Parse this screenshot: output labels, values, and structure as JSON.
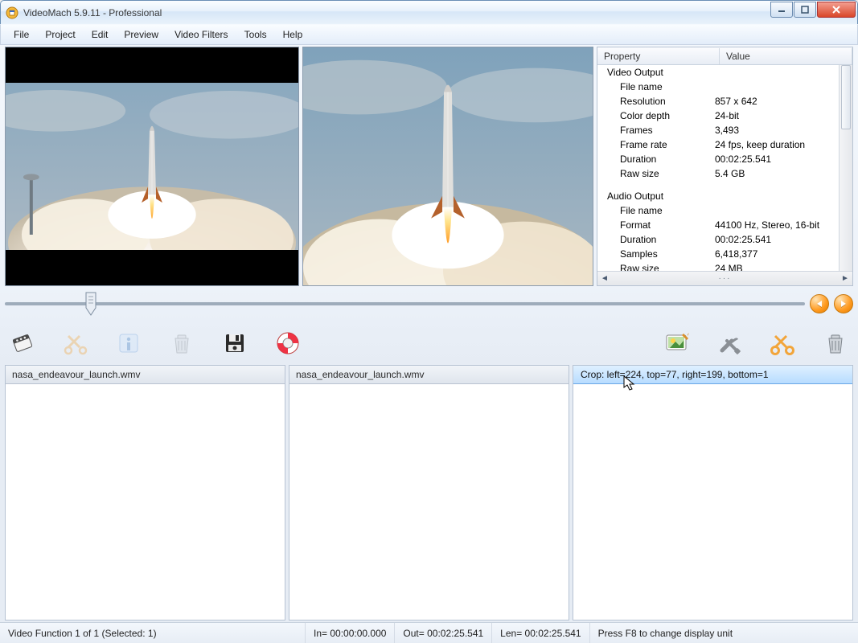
{
  "window": {
    "title": "VideoMach 5.9.11 - Professional"
  },
  "menu": {
    "items": [
      "File",
      "Project",
      "Edit",
      "Preview",
      "Video Filters",
      "Tools",
      "Help"
    ]
  },
  "properties": {
    "header_property": "Property",
    "header_value": "Value",
    "groups": [
      {
        "title": "Video Output",
        "rows": [
          {
            "name": "File name",
            "value": ""
          },
          {
            "name": "Resolution",
            "value": "857 x 642"
          },
          {
            "name": "Color depth",
            "value": "24-bit"
          },
          {
            "name": "Frames",
            "value": "3,493"
          },
          {
            "name": "Frame rate",
            "value": "24 fps, keep duration"
          },
          {
            "name": "Duration",
            "value": "00:02:25.541"
          },
          {
            "name": "Raw size",
            "value": "5.4 GB"
          }
        ]
      },
      {
        "title": "Audio Output",
        "rows": [
          {
            "name": "File name",
            "value": ""
          },
          {
            "name": "Format",
            "value": "44100 Hz, Stereo, 16-bit"
          },
          {
            "name": "Duration",
            "value": "00:02:25.541"
          },
          {
            "name": "Samples",
            "value": "6,418,377"
          },
          {
            "name": "Raw size",
            "value": "24 MB"
          }
        ]
      }
    ]
  },
  "lists": {
    "left_item": "nasa_endeavour_launch.wmv",
    "mid_item": "nasa_endeavour_launch.wmv",
    "right_item": "Crop:  left=224, top=77, right=199, bottom=1"
  },
  "status": {
    "left": "Video Function 1 of 1 (Selected: 1)",
    "in": "In= 00:00:00.000",
    "out": "Out= 00:02:25.541",
    "len": "Len= 00:02:25.541",
    "right": "Press F8 to change display unit"
  }
}
